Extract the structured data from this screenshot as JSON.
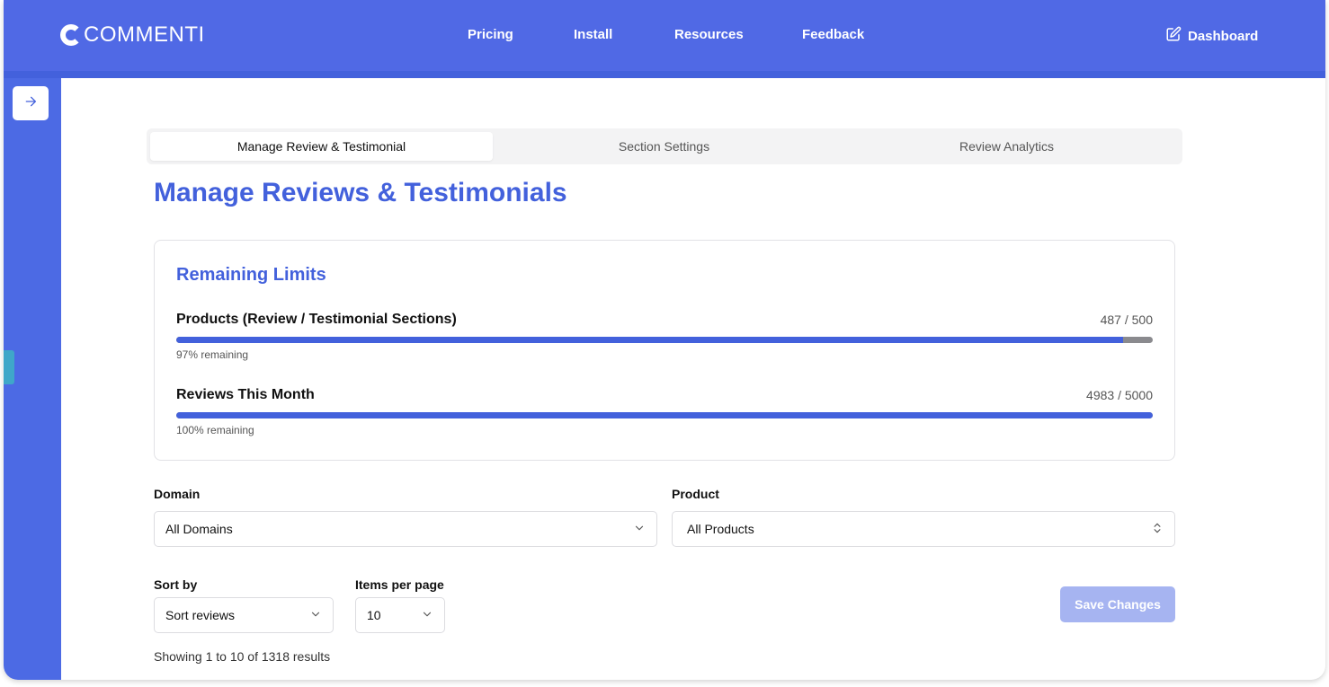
{
  "app": {
    "logo_text": "COMMENTI"
  },
  "nav": {
    "links": [
      {
        "label": "Pricing"
      },
      {
        "label": "Install"
      },
      {
        "label": "Resources"
      },
      {
        "label": "Feedback"
      }
    ],
    "dashboard_label": "Dashboard"
  },
  "tabs": [
    {
      "label": "Manage Review & Testimonial",
      "active": true
    },
    {
      "label": "Section Settings",
      "active": false
    },
    {
      "label": "Review Analytics",
      "active": false
    }
  ],
  "page_title": "Manage Reviews & Testimonials",
  "limits": {
    "title": "Remaining Limits",
    "items": [
      {
        "label": "Products (Review / Testimonial Sections)",
        "count": "487 / 500",
        "fill_fraction": 0.97,
        "note": "97% remaining"
      },
      {
        "label": "Reviews This Month",
        "count": "4983 / 5000",
        "fill_fraction": 1.0,
        "note": "100% remaining"
      }
    ]
  },
  "filters": {
    "domain": {
      "label": "Domain",
      "value": "All Domains"
    },
    "product": {
      "label": "Product",
      "value": "All Products"
    },
    "sort": {
      "label": "Sort by",
      "value": "Sort reviews"
    },
    "per_page": {
      "label": "Items per page",
      "value": "10"
    }
  },
  "save_label": "Save Changes",
  "results_text": "Showing 1 to 10 of 1318 results",
  "colors": {
    "primary": "#4361dc",
    "nav": "#5069e5",
    "save_disabled": "#a6b4f1"
  }
}
